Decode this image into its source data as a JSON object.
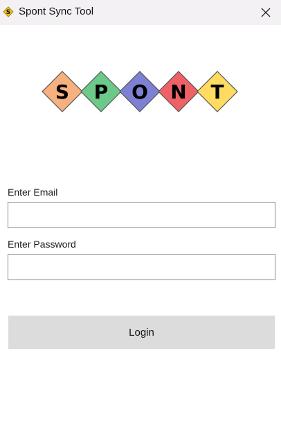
{
  "window": {
    "title": "Spont Sync Tool",
    "app_icon_letter": "S",
    "close_icon": "close-icon"
  },
  "logo": {
    "letters": [
      {
        "char": "S",
        "color": "#f6b17f"
      },
      {
        "char": "P",
        "color": "#6cc98a"
      },
      {
        "char": "O",
        "color": "#7d80d3"
      },
      {
        "char": "N",
        "color": "#ee6266"
      },
      {
        "char": "T",
        "color": "#ffdb62"
      }
    ]
  },
  "form": {
    "email_label": "Enter Email",
    "email_value": "",
    "password_label": "Enter Password",
    "password_value": "",
    "login_label": "Login"
  },
  "colors": {
    "titlebar_bg": "#f3f1f3",
    "button_bg": "#dcdcdc",
    "input_border": "#8a8a8a",
    "app_icon_bg": "#f5c518"
  }
}
